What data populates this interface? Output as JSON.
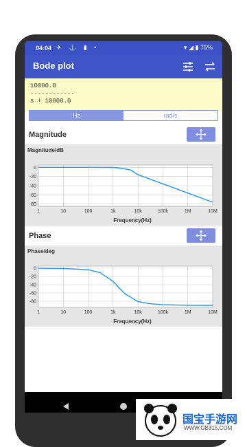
{
  "status": {
    "time": "04:04",
    "battery": "75%"
  },
  "app": {
    "title": "Bode plot"
  },
  "transfer_function": {
    "numerator": "10000.0",
    "divider": "------------",
    "denominator": "s + 10000.0"
  },
  "units": {
    "options": [
      "Hz",
      "rad/s"
    ],
    "selected": "Hz"
  },
  "magnitude": {
    "section_title": "Magnitude",
    "chart_data": {
      "type": "line",
      "title": "",
      "ylabel": "Magnitude/dB",
      "xlabel": "Frequency(Hz)",
      "x_scale": "log",
      "x_ticks": [
        "1",
        "10",
        "100",
        "1k",
        "10k",
        "100k",
        "1M",
        "10M"
      ],
      "y_ticks": [
        "0",
        "-20",
        "-40",
        "-60",
        "-80"
      ],
      "ylim": [
        -85,
        5
      ],
      "grid": true,
      "series": [
        {
          "x": [
            1,
            10,
            100,
            1000,
            1592,
            5000,
            10000,
            100000,
            1000000,
            10000000
          ],
          "y": [
            0,
            0,
            0,
            -0.2,
            -1,
            -5.7,
            -16,
            -36,
            -56,
            -76
          ]
        }
      ]
    }
  },
  "phase": {
    "section_title": "Phase",
    "chart_data": {
      "type": "line",
      "title": "",
      "ylabel": "Phase/deg",
      "xlabel": "Frequency(Hz)",
      "x_scale": "log",
      "x_ticks": [
        "1",
        "10",
        "100",
        "1k",
        "10k",
        "100k",
        "1M",
        "10M"
      ],
      "y_ticks": [
        "0",
        "-20",
        "-40",
        "-60",
        "-80"
      ],
      "ylim": [
        -95,
        5
      ],
      "grid": true,
      "series": [
        {
          "x": [
            1,
            10,
            100,
            300,
            1000,
            1592,
            3000,
            10000,
            30000,
            100000,
            1000000,
            10000000
          ],
          "y": [
            -0.1,
            -0.6,
            -3.6,
            -10.7,
            -32,
            -45,
            -62,
            -81,
            -86,
            -88.5,
            -89.8,
            -90
          ]
        }
      ]
    }
  },
  "watermark": {
    "brand": "国宝手游网",
    "url": "WWW.GB315.COM"
  },
  "colors": {
    "primary": "#4055c8",
    "accent": "#7f8de0",
    "line": "#2196f3"
  }
}
